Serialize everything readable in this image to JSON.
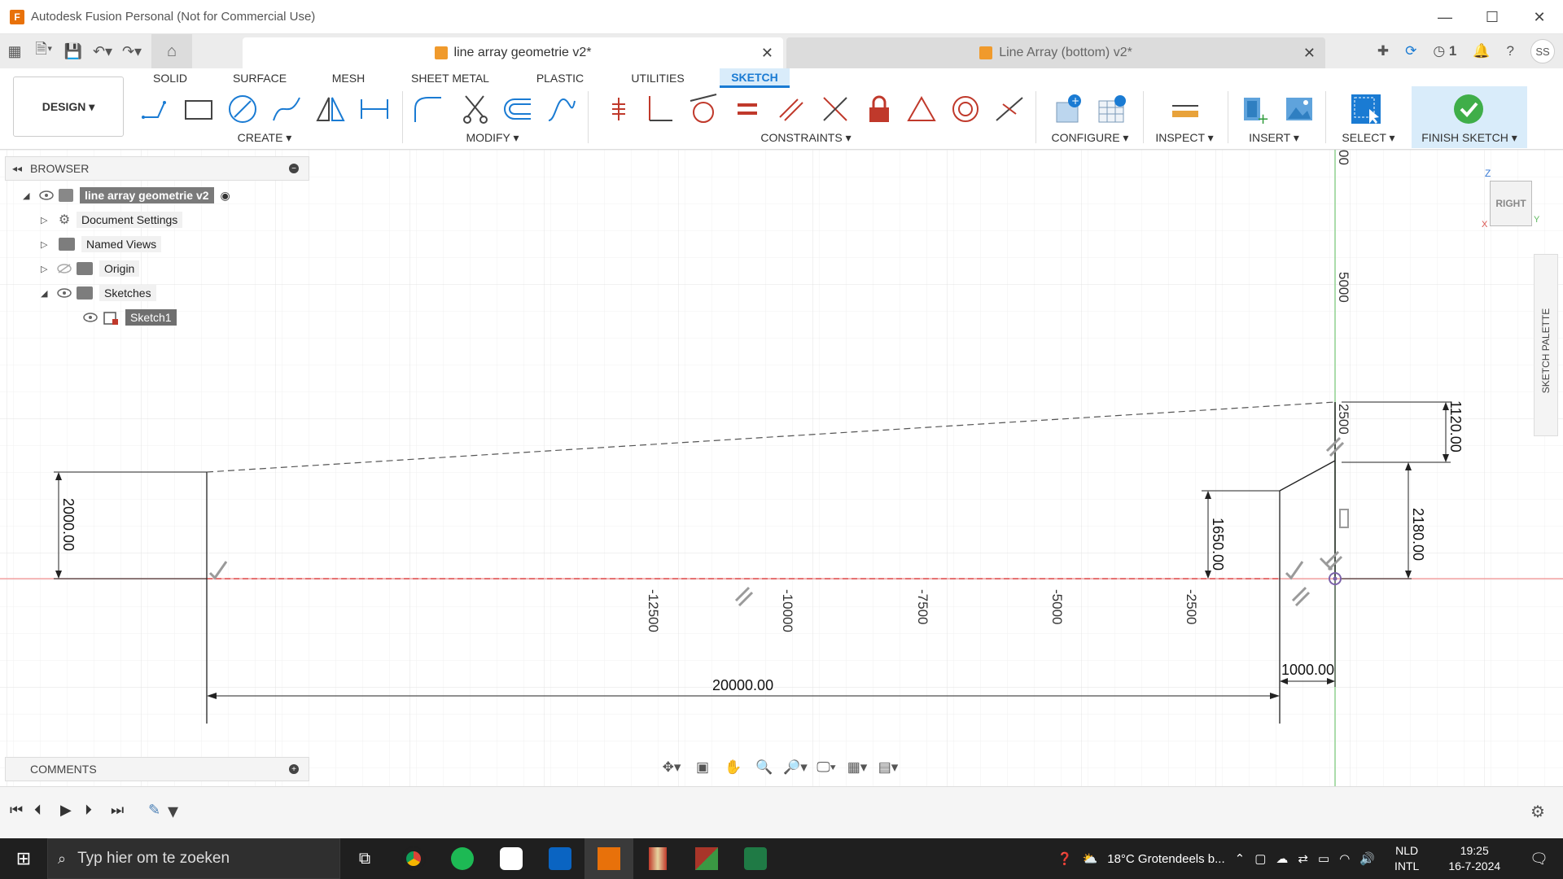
{
  "window": {
    "title": "Autodesk Fusion Personal (Not for Commercial Use)",
    "logo_letter": "F",
    "minimize": "—",
    "maximize": "☐",
    "close": "✕"
  },
  "tabs": {
    "active": {
      "label": "line array geometrie v2*",
      "close": "✕"
    },
    "inactive": {
      "label": "Line Array (bottom) v2*",
      "close": "✕"
    }
  },
  "toolbar_right": {
    "job_count": "1",
    "user_initials": "SS"
  },
  "ribbon": {
    "workspace": "DESIGN ▾",
    "tabs": [
      "SOLID",
      "SURFACE",
      "MESH",
      "SHEET METAL",
      "PLASTIC",
      "UTILITIES",
      "SKETCH"
    ],
    "active_tab": "SKETCH",
    "groups": {
      "create": "CREATE ▾",
      "modify": "MODIFY ▾",
      "constraints": "CONSTRAINTS ▾",
      "configure": "CONFIGURE ▾",
      "inspect": "INSPECT ▾",
      "insert": "INSERT ▾",
      "select": "SELECT ▾",
      "finish": "FINISH SKETCH ▾"
    },
    "accent": "#1a7bd3"
  },
  "browser": {
    "title": "BROWSER",
    "root": "line array geometrie v2",
    "items": [
      {
        "label": "Document Settings"
      },
      {
        "label": "Named Views"
      },
      {
        "label": "Origin"
      },
      {
        "label": "Sketches"
      },
      {
        "label": "Sketch1"
      }
    ]
  },
  "comments": {
    "title": "COMMENTS"
  },
  "viewcube": {
    "face": "RIGHT",
    "z": "Z",
    "y": "Y",
    "x": "X"
  },
  "sketch_palette": {
    "label": "SKETCH PALETTE"
  },
  "axis_labels": {
    "h": [
      "-12500",
      "-10000",
      "-7500",
      "-5000",
      "-2500"
    ],
    "v_top": "00",
    "v_5000": "5000",
    "v_2500": "2500"
  },
  "dimensions": {
    "left_height": "2000.00",
    "length": "20000.00",
    "short_length": "1000.00",
    "mid_height": "1650.00",
    "right_height": "2180.00",
    "top_height": "1120.00"
  },
  "taskbar": {
    "search_placeholder": "Typ hier om te zoeken",
    "weather": "18°C  Grotendeels b...",
    "lang_top": "NLD",
    "lang_bottom": "INTL",
    "time": "19:25",
    "date": "16-7-2024"
  }
}
